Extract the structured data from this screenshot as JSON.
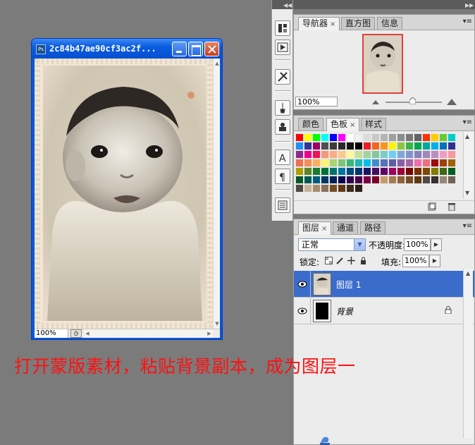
{
  "document": {
    "title": "2c84b47ae90cf3ac2f...",
    "app_icon_text": "Ps",
    "zoom": "100%"
  },
  "navigator_panel": {
    "tabs": [
      {
        "label": "导航器",
        "active": true
      },
      {
        "label": "直方图",
        "active": false
      },
      {
        "label": "信息",
        "active": false
      }
    ],
    "zoom": "100%"
  },
  "swatches_panel": {
    "tabs": [
      {
        "label": "颜色",
        "active": false
      },
      {
        "label": "色板",
        "active": true
      },
      {
        "label": "样式",
        "active": false
      }
    ],
    "colors": [
      "#ff0000",
      "#ffff00",
      "#00ff00",
      "#00ffff",
      "#0000ff",
      "#ff00ff",
      "#ffffff",
      "#f0f0f0",
      "#dcdcdc",
      "#c8c8c8",
      "#b4b4b4",
      "#a0a0a0",
      "#8c8c8c",
      "#787878",
      "#646464",
      "#ff3300",
      "#ffcc00",
      "#66cc33",
      "#00cccc",
      "#1e90ff",
      "#333399",
      "#990066",
      "#505050",
      "#3c3c3c",
      "#282828",
      "#141414",
      "#000000",
      "#ed1c24",
      "#f26522",
      "#f7941d",
      "#fff200",
      "#8dc63f",
      "#39b54a",
      "#00a651",
      "#00a99d",
      "#00aeef",
      "#0072bc",
      "#2e3192",
      "#92278f",
      "#ec008c",
      "#ed145b",
      "#f7977a",
      "#f9ad81",
      "#fdc68a",
      "#fff79a",
      "#c4df9b",
      "#a3d39c",
      "#82ca9d",
      "#7bcdc8",
      "#6ecff6",
      "#7ea7d8",
      "#8493ca",
      "#8882be",
      "#a187be",
      "#bc8dbf",
      "#f49ac2",
      "#f6989d",
      "#f26c4f",
      "#f68e55",
      "#fbaf5c",
      "#fff467",
      "#acd372",
      "#7cc576",
      "#3bb878",
      "#1abbb4",
      "#00bff3",
      "#438ccb",
      "#5574b9",
      "#605ca8",
      "#855fa8",
      "#a763a8",
      "#f06ea9",
      "#f26d7d",
      "#9e0b0f",
      "#a0410d",
      "#a36209",
      "#aba000",
      "#598527",
      "#1a7b30",
      "#007236",
      "#00746b",
      "#0076a3",
      "#004a80",
      "#003471",
      "#1b1464",
      "#440e62",
      "#630460",
      "#9e005d",
      "#9e0039",
      "#790000",
      "#7b2e00",
      "#7d4900",
      "#827b00",
      "#406618",
      "#005e20",
      "#005826",
      "#005952",
      "#005b7f",
      "#003663",
      "#002157",
      "#0d004c",
      "#32004b",
      "#4b0049",
      "#7b0046",
      "#7a0026",
      "#c69c6e",
      "#a67c52",
      "#8c6239",
      "#754c24",
      "#603913",
      "#534741",
      "#362f2d",
      "#998675",
      "#736357",
      "#534741",
      "#c7b299",
      "#a68b6d",
      "#8c7156",
      "#754c24",
      "#603913",
      "#3c2b1f",
      "#2b1d14"
    ]
  },
  "layers_panel": {
    "tabs": [
      {
        "label": "图层",
        "active": true
      },
      {
        "label": "通道",
        "active": false
      },
      {
        "label": "路径",
        "active": false
      }
    ],
    "blend_mode": "正常",
    "opacity_label": "不透明度:",
    "opacity": "100%",
    "lock_label": "锁定:",
    "fill_label": "填充:",
    "fill": "100%",
    "layers": [
      {
        "name": "图层 1",
        "selected": true,
        "visible": true
      },
      {
        "name": "背景",
        "selected": false,
        "visible": true,
        "locked": true
      }
    ]
  },
  "caption": "打开蒙版素材，粘贴背景副本，成为图层一"
}
